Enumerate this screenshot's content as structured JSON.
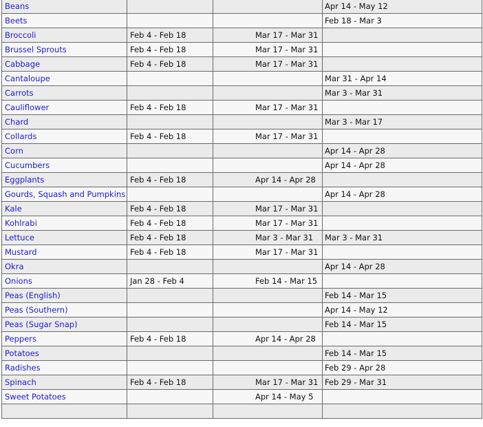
{
  "rows": [
    {
      "name": "Beans",
      "c1": "",
      "c2": "",
      "c3": "Apr 14 - May 12"
    },
    {
      "name": "Beets",
      "c1": "",
      "c2": "",
      "c3": "Feb 18 - Mar 3"
    },
    {
      "name": "Broccoli",
      "c1": "Feb 4 - Feb 18",
      "c2": "Mar 17 - Mar 31",
      "c3": ""
    },
    {
      "name": "Brussel Sprouts",
      "c1": "Feb 4 - Feb 18",
      "c2": "Mar 17 - Mar 31",
      "c3": ""
    },
    {
      "name": "Cabbage",
      "c1": "Feb 4 - Feb 18",
      "c2": "Mar 17 - Mar 31",
      "c3": ""
    },
    {
      "name": "Cantaloupe",
      "c1": "",
      "c2": "",
      "c3": "Mar 31 - Apr 14"
    },
    {
      "name": "Carrots",
      "c1": "",
      "c2": "",
      "c3": "Mar 3 - Mar 31"
    },
    {
      "name": "Cauliflower",
      "c1": "Feb 4 - Feb 18",
      "c2": "Mar 17 - Mar 31",
      "c3": ""
    },
    {
      "name": "Chard",
      "c1": "",
      "c2": "",
      "c3": "Mar 3 - Mar 17"
    },
    {
      "name": "Collards",
      "c1": "Feb 4 - Feb 18",
      "c2": "Mar 17 - Mar 31",
      "c3": ""
    },
    {
      "name": "Corn",
      "c1": "",
      "c2": "",
      "c3": "Apr 14 - Apr 28"
    },
    {
      "name": "Cucumbers",
      "c1": "",
      "c2": "",
      "c3": "Apr 14 - Apr 28"
    },
    {
      "name": "Eggplants",
      "c1": "Feb 4 - Feb 18",
      "c2": "Apr 14 - Apr 28",
      "c3": ""
    },
    {
      "name": "Gourds, Squash and Pumpkins",
      "c1": "",
      "c2": "",
      "c3": "Apr 14 - Apr 28"
    },
    {
      "name": "Kale",
      "c1": "Feb 4 - Feb 18",
      "c2": "Mar 17 - Mar 31",
      "c3": ""
    },
    {
      "name": "Kohlrabi",
      "c1": "Feb 4 - Feb 18",
      "c2": "Mar 17 - Mar 31",
      "c3": ""
    },
    {
      "name": "Lettuce",
      "c1": "Feb 4 - Feb 18",
      "c2": "Mar 3 - Mar 31",
      "c3": "Mar 3 - Mar 31"
    },
    {
      "name": "Mustard",
      "c1": "Feb 4 - Feb 18",
      "c2": "Mar 17 - Mar 31",
      "c3": ""
    },
    {
      "name": "Okra",
      "c1": "",
      "c2": "",
      "c3": "Apr 14 - Apr 28"
    },
    {
      "name": "Onions",
      "c1": "Jan 28 - Feb 4",
      "c2": "Feb 14 - Mar 15",
      "c3": ""
    },
    {
      "name": "Peas (English)",
      "c1": "",
      "c2": "",
      "c3": "Feb 14 - Mar 15"
    },
    {
      "name": "Peas (Southern)",
      "c1": "",
      "c2": "",
      "c3": "Apr 14 - May 12"
    },
    {
      "name": "Peas (Sugar Snap)",
      "c1": "",
      "c2": "",
      "c3": "Feb 14 - Mar 15"
    },
    {
      "name": "Peppers",
      "c1": "Feb 4 - Feb 18",
      "c2": "Apr 14 - Apr 28",
      "c3": ""
    },
    {
      "name": "Potatoes",
      "c1": "",
      "c2": "",
      "c3": "Feb 14 - Mar 15"
    },
    {
      "name": "Radishes",
      "c1": "",
      "c2": "",
      "c3": "Feb 29 - Apr 28"
    },
    {
      "name": "Spinach",
      "c1": "Feb 4 - Feb 18",
      "c2": "Mar 17 - Mar 31",
      "c3": "Feb 29 - Mar 31"
    },
    {
      "name": "Sweet Potatoes",
      "c1": "",
      "c2": "Apr 14 - May 5",
      "c3": ""
    },
    {
      "name": "",
      "c1": "",
      "c2": "",
      "c3": ""
    }
  ]
}
